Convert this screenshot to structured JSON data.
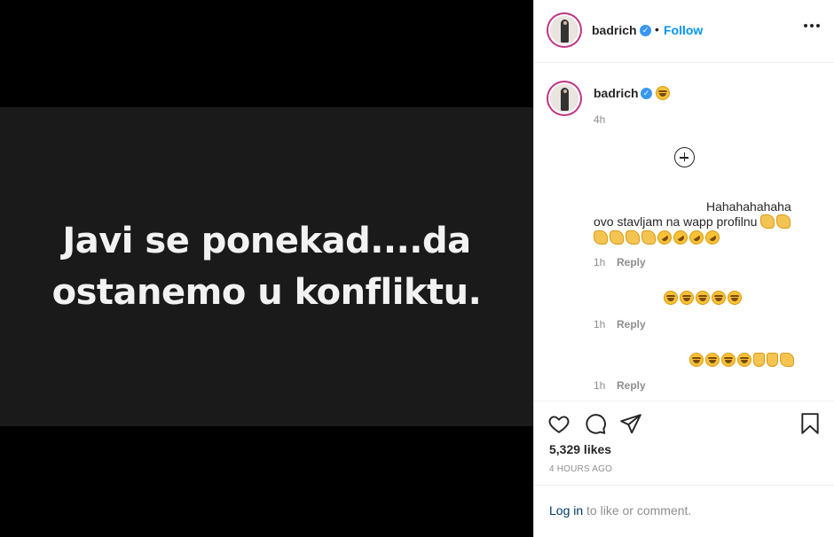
{
  "media": {
    "line1": "Javi se ponekad....da",
    "line2": "ostanemo u konfliktu."
  },
  "header": {
    "username": "badrich",
    "separator": "•",
    "follow_label": "Follow"
  },
  "caption": {
    "username": "badrich",
    "time": "4h"
  },
  "comments": [
    {
      "text_line1": "Hahahahahaha",
      "text_line2": "ovo stavljam na wapp profilnu",
      "time": "1h",
      "reply": "Reply"
    },
    {
      "time": "1h",
      "reply": "Reply"
    },
    {
      "time": "1h",
      "reply": "Reply"
    }
  ],
  "stats": {
    "likes": "5,329 likes",
    "posted": "4 HOURS AGO"
  },
  "footer": {
    "login": "Log in",
    "rest": " to like or comment."
  },
  "icons": [
    "verified-badge-icon",
    "more-options-icon",
    "load-more-comments-icon",
    "heart-icon",
    "comment-icon",
    "share-icon",
    "bookmark-icon"
  ],
  "colors": {
    "accent": "#0095f6",
    "verified": "#3897f0",
    "muted": "#8e8e8e",
    "text": "#262626"
  }
}
